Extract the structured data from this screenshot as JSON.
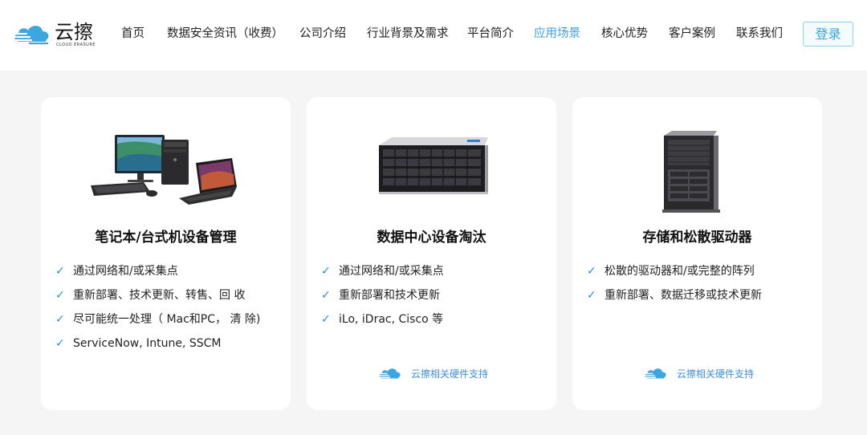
{
  "brand": {
    "name": "云擦",
    "subtitle": "CLOUD ERASURE",
    "color": "#3ba7de"
  },
  "nav": {
    "items": [
      {
        "label": "首页"
      },
      {
        "label": "数据安全资讯（收费）"
      },
      {
        "label": "公司介绍"
      },
      {
        "label": "行业背景及需求"
      },
      {
        "label": "平台简介"
      },
      {
        "label": "应用场景",
        "active": true
      },
      {
        "label": "核心优势"
      },
      {
        "label": "客户案例"
      },
      {
        "label": "联系我们"
      }
    ],
    "login_label": "登录"
  },
  "cards": [
    {
      "title": "笔记本/台式机设备管理",
      "image_icon": "desktop-laptop-icon",
      "items": [
        "通过网络和/或采集点",
        "重新部署、技术更新、转售、回 收",
        "尽可能统一处理（ Mac和PC， 清 除)",
        "ServiceNow, Intune, SSCM"
      ]
    },
    {
      "title": "数据中心设备淘汰",
      "image_icon": "rack-server-icon",
      "items": [
        "通过网络和/或采集点",
        "重新部署和技术更新",
        "iLo, iDrac, Cisco 等"
      ],
      "support_label": "云擦相关硬件支持"
    },
    {
      "title": "存储和松散驱动器",
      "image_icon": "tower-server-icon",
      "items": [
        "松散的驱动器和/或完整的阵列",
        "重新部署、数据迁移或技术更新"
      ],
      "support_label": "云擦相关硬件支持"
    }
  ],
  "check_glyph": "✓",
  "colors": {
    "accent": "#3fa0d8",
    "check": "#2f8fd4",
    "background": "#f5f5f5"
  }
}
